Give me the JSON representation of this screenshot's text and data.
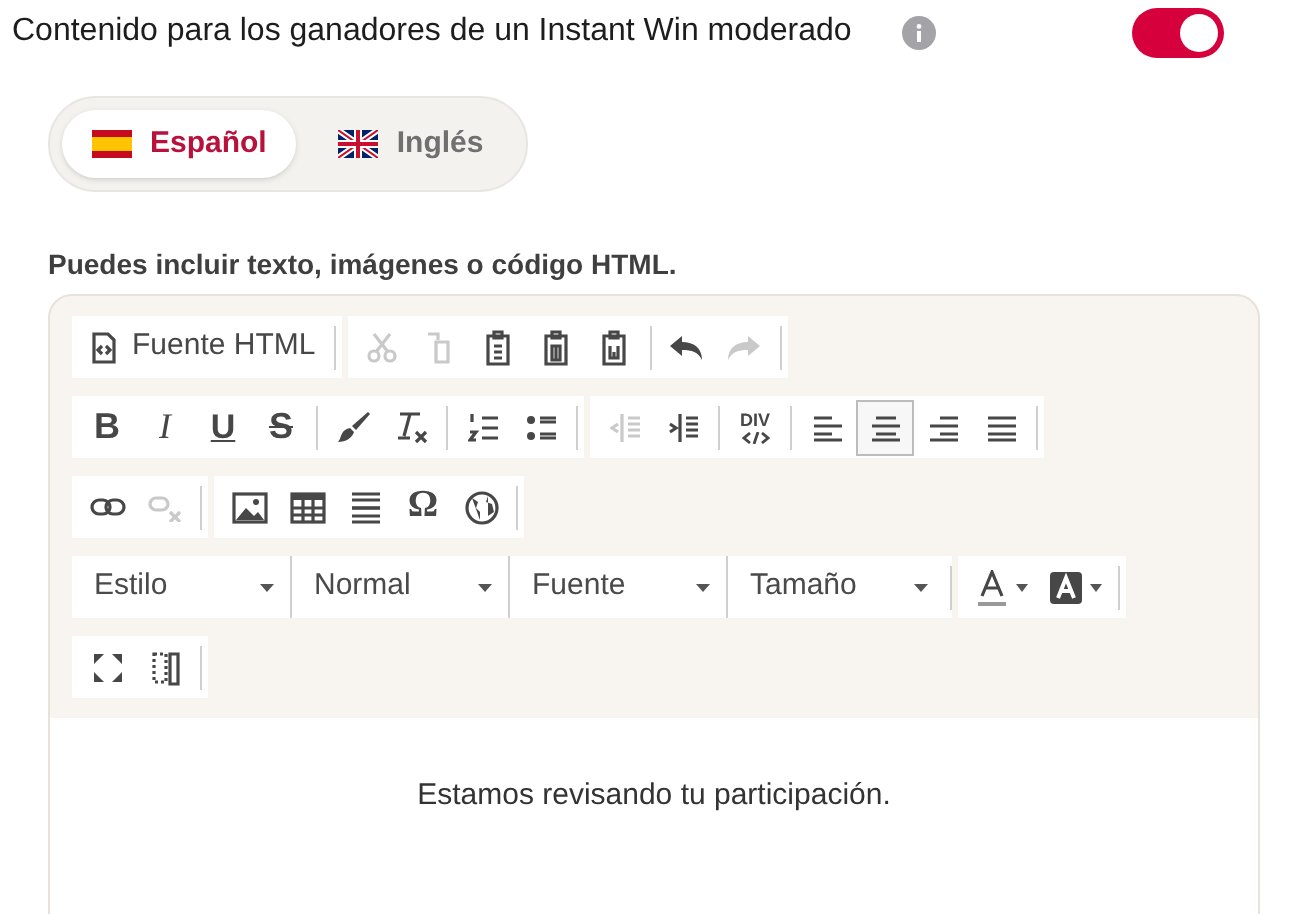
{
  "header": {
    "title": "Contenido para los ganadores de un Instant Win moderado",
    "toggle": {
      "on": true
    }
  },
  "language_tabs": [
    {
      "label": "Español",
      "selected": true
    },
    {
      "label": "Inglés",
      "selected": false
    }
  ],
  "editor_hint": "Puedes incluir texto, imágenes o código HTML.",
  "toolbar_rows": [
    [
      [
        {
          "kind": "text",
          "label": "Fuente HTML",
          "disabled": false
        }
      ],
      [
        {
          "kind": "icon",
          "disabled": true
        },
        {
          "kind": "icon",
          "disabled": true
        },
        {
          "kind": "icon",
          "disabled": false
        },
        {
          "kind": "icon",
          "disabled": false
        },
        {
          "kind": "icon",
          "disabled": false
        },
        {
          "kind": "sep"
        },
        {
          "kind": "icon",
          "disabled": false
        },
        {
          "kind": "icon",
          "disabled": true
        }
      ]
    ],
    [
      [
        {
          "kind": "glyph",
          "label": "B",
          "disabled": false,
          "selected": false
        },
        {
          "kind": "glyph",
          "label": "I",
          "disabled": false,
          "selected": false
        },
        {
          "kind": "glyph",
          "label": "U",
          "disabled": false,
          "selected": false
        },
        {
          "kind": "glyph",
          "label": "S",
          "disabled": false,
          "selected": false
        },
        {
          "kind": "sep"
        },
        {
          "kind": "icon",
          "disabled": false
        },
        {
          "kind": "icon",
          "disabled": false
        },
        {
          "kind": "sep"
        },
        {
          "kind": "icon",
          "disabled": false
        },
        {
          "kind": "icon",
          "disabled": false
        }
      ],
      [
        {
          "kind": "icon",
          "disabled": true
        },
        {
          "kind": "icon",
          "disabled": false
        },
        {
          "kind": "sep"
        },
        {
          "kind": "div",
          "label": "DIV",
          "disabled": false
        },
        {
          "kind": "sep"
        },
        {
          "kind": "icon",
          "disabled": false,
          "selected": false
        },
        {
          "kind": "icon",
          "disabled": false,
          "selected": true
        },
        {
          "kind": "icon",
          "disabled": false,
          "selected": false
        },
        {
          "kind": "icon",
          "disabled": false,
          "selected": false
        }
      ]
    ],
    [
      [
        {
          "kind": "icon",
          "disabled": false
        },
        {
          "kind": "icon",
          "disabled": true
        }
      ],
      [
        {
          "kind": "icon",
          "disabled": false
        },
        {
          "kind": "icon",
          "disabled": false
        },
        {
          "kind": "icon",
          "disabled": false
        },
        {
          "kind": "glyph",
          "label": "Ω",
          "disabled": false,
          "selected": false
        },
        {
          "kind": "icon",
          "disabled": false
        }
      ]
    ],
    [
      [
        {
          "kind": "dropdown",
          "label": "Estilo"
        },
        {
          "kind": "dropdown",
          "label": "Normal"
        },
        {
          "kind": "dropdown",
          "label": "Fuente"
        },
        {
          "kind": "dropdown",
          "label": "Tamaño"
        }
      ],
      [
        {
          "kind": "color",
          "disabled": false
        },
        {
          "kind": "color",
          "disabled": false
        }
      ]
    ],
    [
      [
        {
          "kind": "icon",
          "disabled": false
        },
        {
          "kind": "icon",
          "disabled": false
        }
      ]
    ]
  ],
  "content": "Estamos revisando tu participación."
}
